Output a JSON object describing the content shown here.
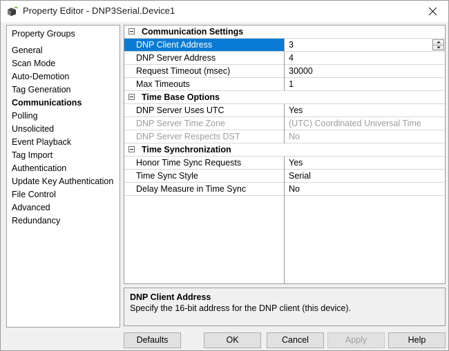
{
  "window": {
    "title": "Property Editor - DNP3Serial.Device1",
    "icon": "device-cube-icon",
    "close_label": "×",
    "accent_color": "#0a7bd4",
    "disabled_text_color": "#9d9d9d"
  },
  "sidebar": {
    "header": "Property Groups",
    "items": [
      {
        "label": "General",
        "selected": false
      },
      {
        "label": "Scan Mode",
        "selected": false
      },
      {
        "label": "Auto-Demotion",
        "selected": false
      },
      {
        "label": "Tag Generation",
        "selected": false
      },
      {
        "label": "Communications",
        "selected": true
      },
      {
        "label": "Polling",
        "selected": false
      },
      {
        "label": "Unsolicited",
        "selected": false
      },
      {
        "label": "Event Playback",
        "selected": false
      },
      {
        "label": "Tag Import",
        "selected": false
      },
      {
        "label": "Authentication",
        "selected": false
      },
      {
        "label": "Update Key Authentication",
        "selected": false
      },
      {
        "label": "File Control",
        "selected": false
      },
      {
        "label": "Advanced",
        "selected": false
      },
      {
        "label": "Redundancy",
        "selected": false
      }
    ]
  },
  "grid": {
    "groups": [
      {
        "title": "Communication Settings",
        "expanded": true,
        "rows": [
          {
            "name": "DNP Client Address",
            "value": "3",
            "selected": true,
            "disabled": false,
            "editor": "spinner"
          },
          {
            "name": "DNP Server Address",
            "value": "4",
            "selected": false,
            "disabled": false,
            "editor": "none"
          },
          {
            "name": "Request Timeout (msec)",
            "value": "30000",
            "selected": false,
            "disabled": false,
            "editor": "none"
          },
          {
            "name": "Max Timeouts",
            "value": "1",
            "selected": false,
            "disabled": false,
            "editor": "none"
          }
        ]
      },
      {
        "title": "Time Base Options",
        "expanded": true,
        "rows": [
          {
            "name": "DNP Server Uses UTC",
            "value": "Yes",
            "selected": false,
            "disabled": false,
            "editor": "none"
          },
          {
            "name": "DNP Server Time Zone",
            "value": "(UTC) Coordinated Universal Time",
            "selected": false,
            "disabled": true,
            "editor": "none"
          },
          {
            "name": "DNP Server Respects DST",
            "value": "No",
            "selected": false,
            "disabled": true,
            "editor": "none"
          }
        ]
      },
      {
        "title": "Time Synchronization",
        "expanded": true,
        "rows": [
          {
            "name": "Honor Time Sync Requests",
            "value": "Yes",
            "selected": false,
            "disabled": false,
            "editor": "none"
          },
          {
            "name": "Time Sync Style",
            "value": "Serial",
            "selected": false,
            "disabled": false,
            "editor": "none"
          },
          {
            "name": "Delay Measure in Time Sync",
            "value": "No",
            "selected": false,
            "disabled": false,
            "editor": "none"
          }
        ]
      }
    ]
  },
  "description": {
    "title": "DNP Client Address",
    "text": "Specify the 16-bit address for the DNP client (this device)."
  },
  "buttons": [
    {
      "id": "defaults",
      "label": "Defaults",
      "disabled": false
    },
    {
      "id": "ok",
      "label": "OK",
      "disabled": false
    },
    {
      "id": "cancel",
      "label": "Cancel",
      "disabled": false
    },
    {
      "id": "apply",
      "label": "Apply",
      "disabled": true
    },
    {
      "id": "help",
      "label": "Help",
      "disabled": false
    }
  ]
}
